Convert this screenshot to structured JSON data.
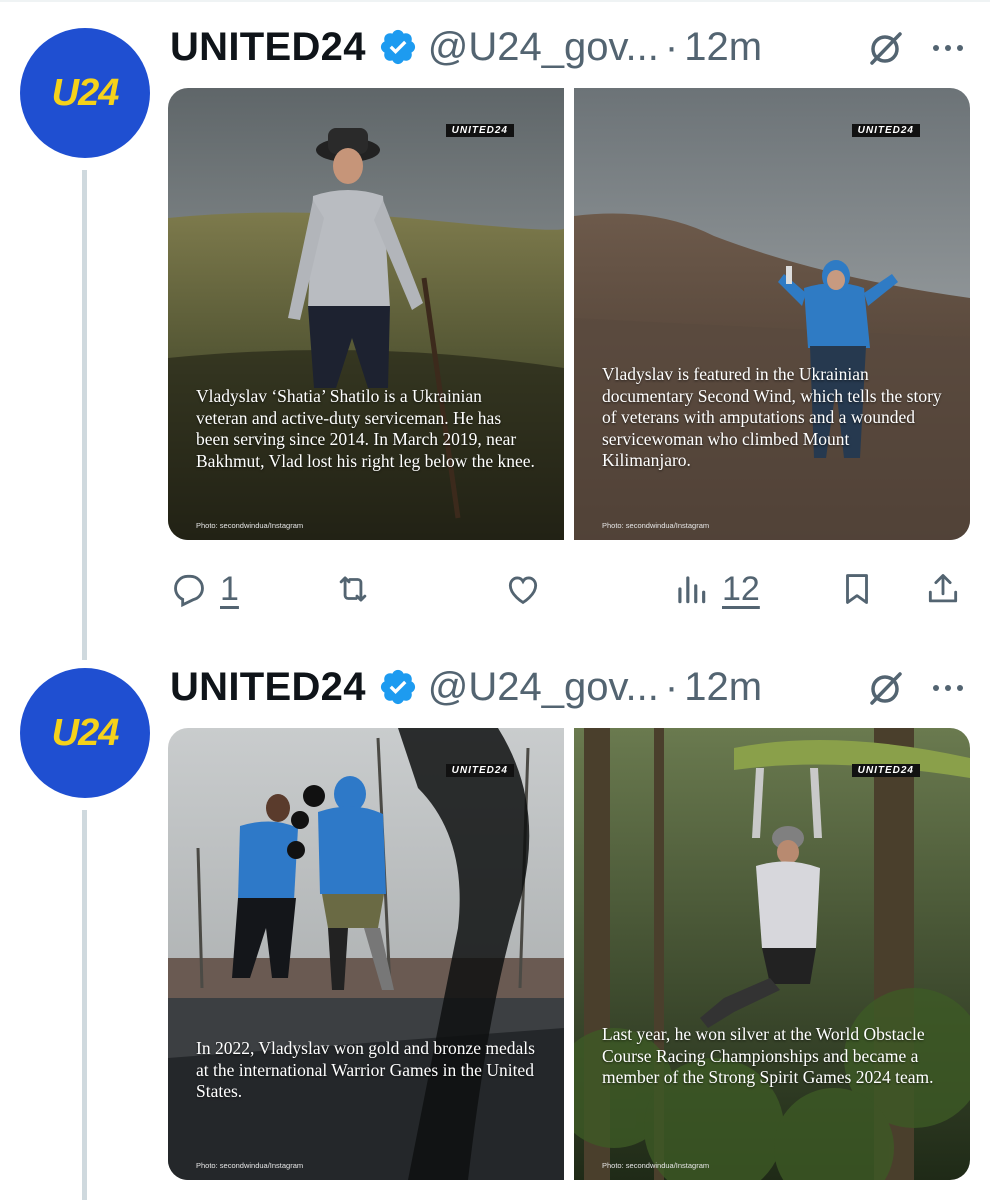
{
  "tweets": [
    {
      "avatar_text": "U24",
      "name": "UNITED24",
      "handle": "@U24_gov...",
      "dot": "·",
      "time": "12m",
      "photos": [
        {
          "watermark": "UNITED24",
          "caption": "Vladyslav ‘Shatia’ Shatilo is a Ukrainian veteran and active-duty serviceman. He has been serving since 2014. In March 2019, near Bakhmut, Vlad lost his right leg below the knee.",
          "credit": "Photo: secondwindua/Instagram"
        },
        {
          "watermark": "UNITED24",
          "caption": "Vladyslav is featured in the Ukrainian documentary Second Wind, which tells the story of veterans with amputations and a wounded servicewoman who climbed Mount Kilimanjaro.",
          "credit": "Photo: secondwindua/Instagram"
        }
      ],
      "actions": {
        "replies": "1",
        "views": "12"
      }
    },
    {
      "avatar_text": "U24",
      "name": "UNITED24",
      "handle": "@U24_gov...",
      "dot": "·",
      "time": "12m",
      "photos": [
        {
          "watermark": "UNITED24",
          "caption": "In 2022, Vladyslav won gold and bronze medals at the international Warrior Games in the United States.",
          "credit": "Photo: secondwindua/Instagram"
        },
        {
          "watermark": "UNITED24",
          "caption": "Last year, he won silver at the World Obstacle Course Racing Championships and became a member of the Strong Spirit Games 2024 team.",
          "credit": "Photo: secondwindua/Instagram"
        }
      ]
    }
  ],
  "colors": {
    "brand_blue": "#1f4fd1",
    "brand_yellow": "#f5d21a",
    "verified_blue": "#1d9bf0",
    "muted": "#536471"
  },
  "icons": [
    "verified-badge-icon",
    "grok-icon",
    "more-icon",
    "reply-icon",
    "retweet-icon",
    "like-icon",
    "views-icon",
    "bookmark-icon",
    "share-icon"
  ]
}
